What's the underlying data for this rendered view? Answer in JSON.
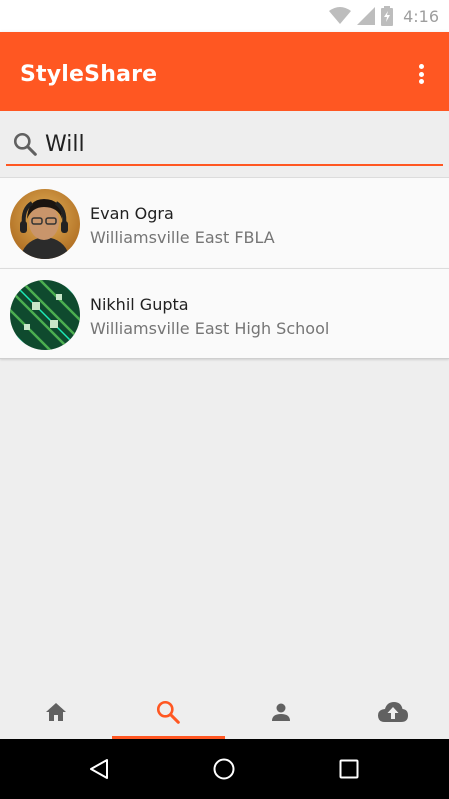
{
  "status_bar": {
    "time": "4:16"
  },
  "app_bar": {
    "title": "StyleShare"
  },
  "search": {
    "value": "Will",
    "placeholder": "Search"
  },
  "results": [
    {
      "name": "Evan Ogra",
      "school": "Williamsville East FBLA"
    },
    {
      "name": "Nikhil Gupta",
      "school": "Williamsville East High School"
    }
  ],
  "bottom_tabs": [
    {
      "icon": "home-icon",
      "active": false
    },
    {
      "icon": "search-icon",
      "active": true
    },
    {
      "icon": "person-icon",
      "active": false
    },
    {
      "icon": "cloud-upload-icon",
      "active": false
    }
  ],
  "colors": {
    "accent": "#ff5722",
    "tab_icon": "#616161",
    "background": "#eeeeee"
  }
}
